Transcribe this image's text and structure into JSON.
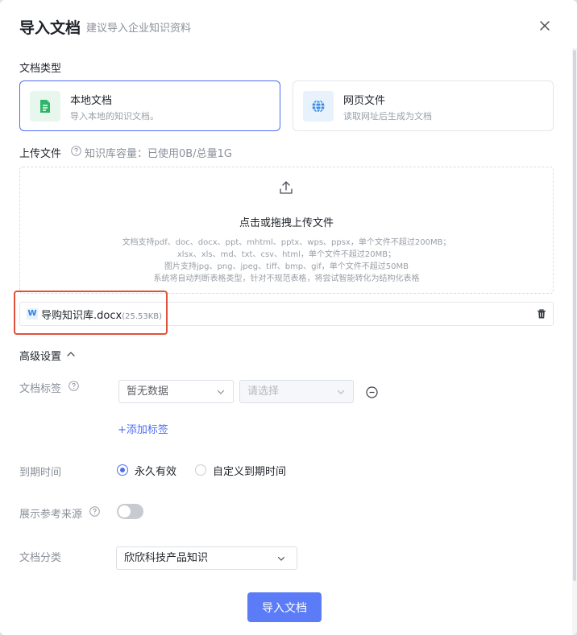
{
  "header": {
    "title": "导入文档",
    "subtitle": "建议导入企业知识资料"
  },
  "doc_type": {
    "label": "文档类型",
    "options": [
      {
        "title": "本地文档",
        "desc": "导入本地的知识文档。",
        "selected": true,
        "icon": "document-icon"
      },
      {
        "title": "网页文件",
        "desc": "读取网址后生成为文档",
        "selected": false,
        "icon": "globe-icon"
      }
    ]
  },
  "upload": {
    "label": "上传文件",
    "quota": "知识库容量：已使用0B/总量1G",
    "title": "点击或拖拽上传文件",
    "lines": [
      "文档支持pdf、doc、docx、ppt、mhtml、pptx、wps、ppsx，单个文件不超过200MB；",
      "xlsx、xls、md、txt、csv、html，单个文件不超过20MB；",
      "图片支持jpg、png、jpeg、tiff、bmp、gif，单个文件不超过50MB",
      "系统将自动判断表格类型，针对不规范表格，将尝试智能转化为结构化表格"
    ]
  },
  "file": {
    "icon_letter": "W",
    "name": "导购知识库.docx",
    "size": "(25.53KB)"
  },
  "advanced": {
    "label": "高级设置",
    "tags": {
      "label": "文档标签",
      "select1": "暂无数据",
      "select2_placeholder": "请选择",
      "add_label": "+添加标签"
    },
    "expiry": {
      "label": "到期时间",
      "option1": "永久有效",
      "option2": "自定义到期时间",
      "selected": "永久有效"
    },
    "source": {
      "label": "展示参考来源",
      "enabled": false
    },
    "category": {
      "label": "文档分类",
      "value": "欣欣科技产品知识"
    }
  },
  "submit_label": "导入文档",
  "colors": {
    "accent": "#4e6ef2",
    "button": "#5b7cf6",
    "highlight": "#e0513b"
  }
}
